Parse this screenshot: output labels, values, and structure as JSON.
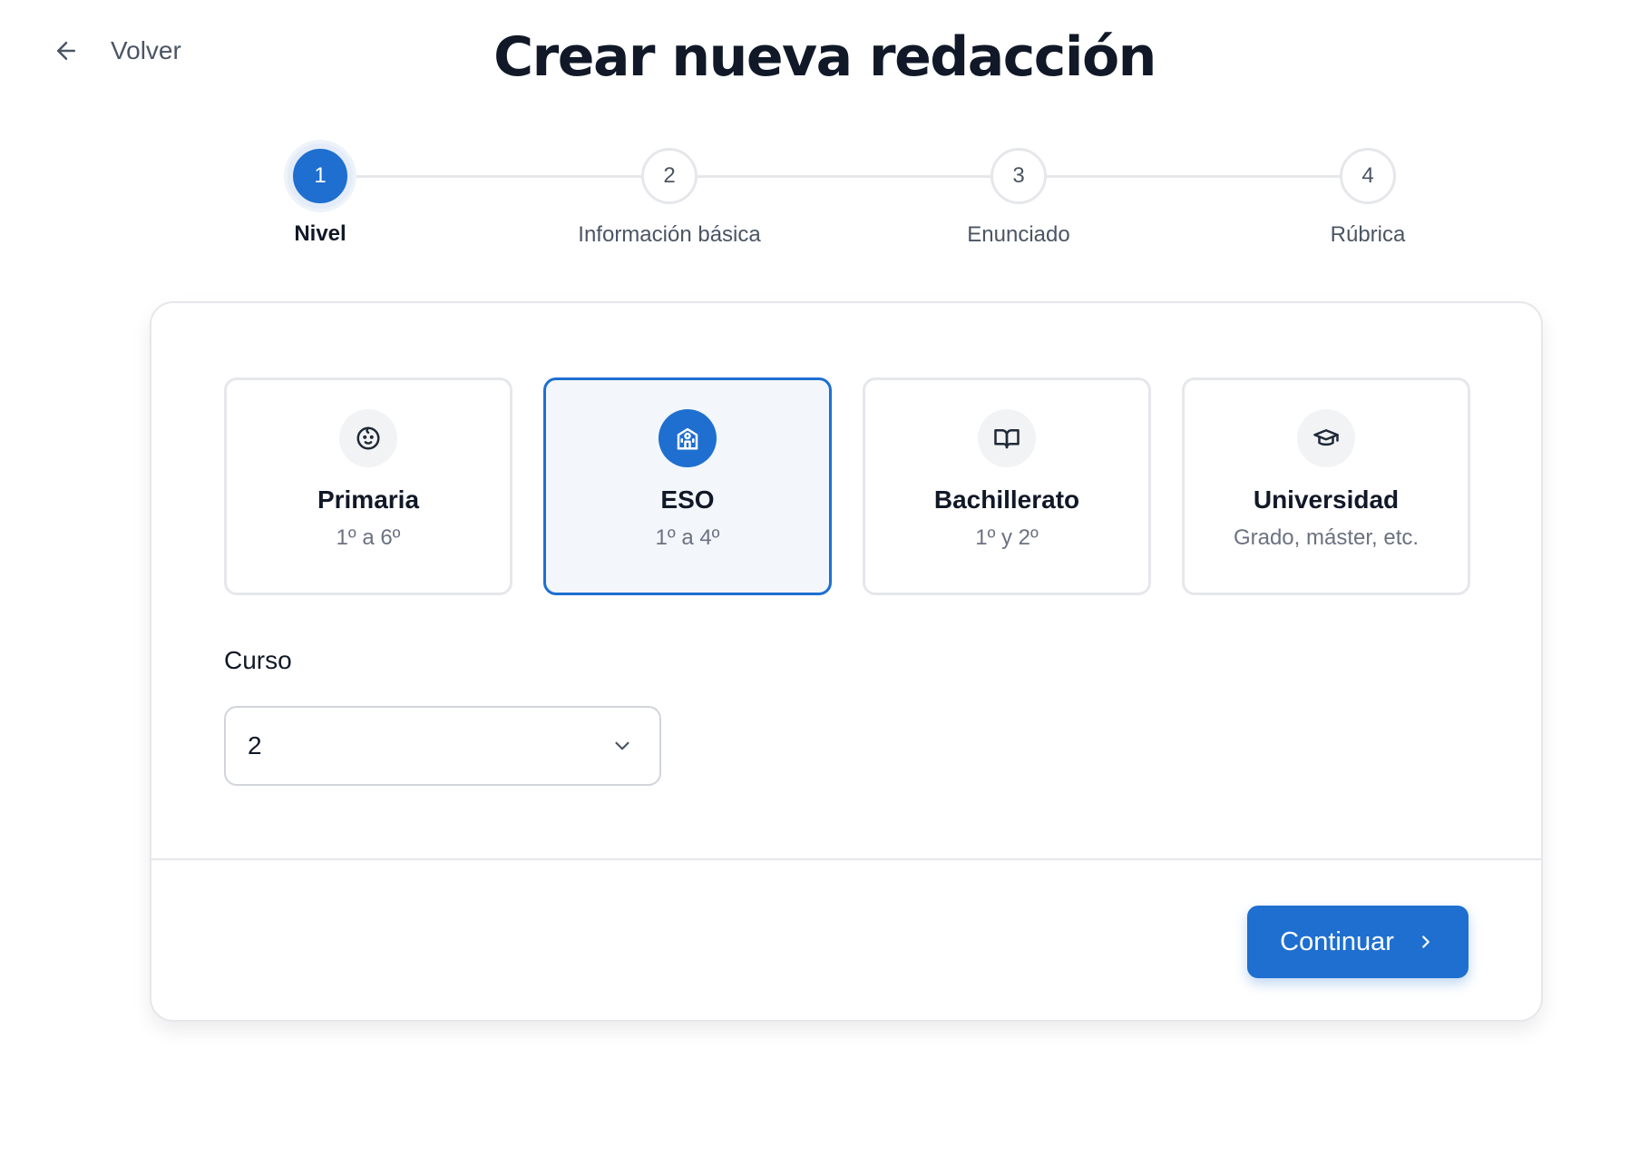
{
  "header": {
    "back_label": "Volver",
    "back_icon": "arrow-left-icon",
    "title": "Crear nueva redacción"
  },
  "stepper": {
    "steps": [
      {
        "number": "1",
        "label": "Nivel",
        "active": true
      },
      {
        "number": "2",
        "label": "Información básica",
        "active": false
      },
      {
        "number": "3",
        "label": "Enunciado",
        "active": false
      },
      {
        "number": "4",
        "label": "Rúbrica",
        "active": false
      }
    ]
  },
  "levels": [
    {
      "title": "Primaria",
      "subtitle": "1º a 6º",
      "icon": "baby-face-icon",
      "selected": false
    },
    {
      "title": "ESO",
      "subtitle": "1º a 4º",
      "icon": "school-icon",
      "selected": true
    },
    {
      "title": "Bachillerato",
      "subtitle": "1º y 2º",
      "icon": "book-open-icon",
      "selected": false
    },
    {
      "title": "Universidad",
      "subtitle": "Grado, máster, etc.",
      "icon": "graduation-cap-icon",
      "selected": false
    }
  ],
  "curso": {
    "label": "Curso",
    "value": "2"
  },
  "actions": {
    "continue_label": "Continuar"
  },
  "colors": {
    "accent": "#1e6fd0",
    "selected_bg": "#f3f6fa",
    "border": "#e5e7eb"
  }
}
